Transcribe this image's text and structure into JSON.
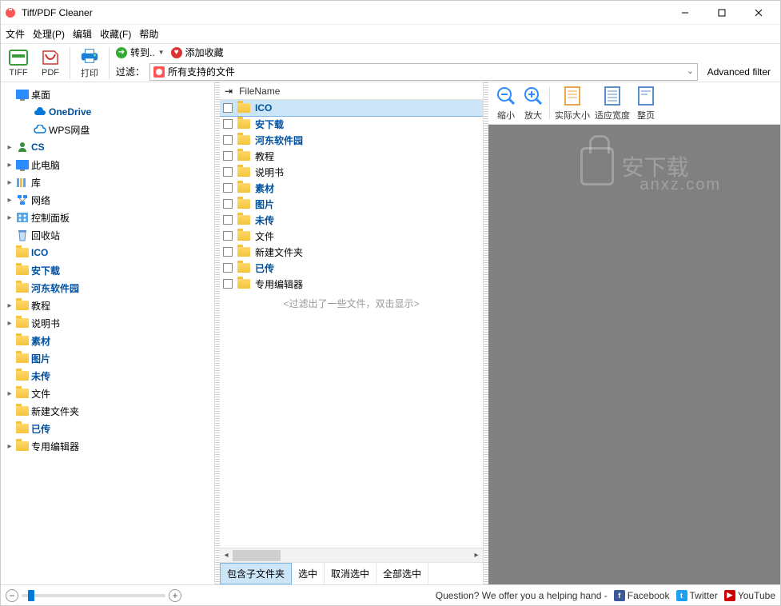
{
  "app": {
    "title": "Tiff/PDF Cleaner"
  },
  "menu": [
    "文件",
    "处理(P)",
    "编辑",
    "收藏(F)",
    "帮助"
  ],
  "toolbar": {
    "tiff": "TIFF",
    "pdf": "PDF",
    "print": "打印",
    "convert": "转到..",
    "favorite": "添加收藏",
    "filter_label": "过滤：",
    "filter_value": "所有支持的文件",
    "advanced": "Advanced filter"
  },
  "tree": [
    {
      "indent": 0,
      "exp": "",
      "icon": "monitor",
      "label": "桌面",
      "bold": false
    },
    {
      "indent": 1,
      "exp": "",
      "icon": "cloud-blue",
      "label": "OneDrive",
      "bold": true
    },
    {
      "indent": 1,
      "exp": "",
      "icon": "cloud-outline",
      "label": "WPS网盘",
      "bold": false
    },
    {
      "indent": 0,
      "exp": "▸",
      "icon": "user",
      "label": "CS",
      "bold": true
    },
    {
      "indent": 0,
      "exp": "▸",
      "icon": "monitor",
      "label": "此电脑",
      "bold": false
    },
    {
      "indent": 0,
      "exp": "▸",
      "icon": "library",
      "label": "库",
      "bold": false
    },
    {
      "indent": 0,
      "exp": "▸",
      "icon": "network",
      "label": "网络",
      "bold": false
    },
    {
      "indent": 0,
      "exp": "▸",
      "icon": "panel",
      "label": "控制面板",
      "bold": false
    },
    {
      "indent": 0,
      "exp": "",
      "icon": "recycle",
      "label": "回收站",
      "bold": false
    },
    {
      "indent": 0,
      "exp": "",
      "icon": "folder",
      "label": "ICO",
      "bold": true
    },
    {
      "indent": 0,
      "exp": "",
      "icon": "folder",
      "label": "安下载",
      "bold": true
    },
    {
      "indent": 0,
      "exp": "",
      "icon": "folder",
      "label": "河东软件园",
      "bold": true
    },
    {
      "indent": 0,
      "exp": "▸",
      "icon": "folder",
      "label": "教程",
      "bold": false
    },
    {
      "indent": 0,
      "exp": "▸",
      "icon": "folder",
      "label": "说明书",
      "bold": false
    },
    {
      "indent": 0,
      "exp": "",
      "icon": "folder",
      "label": "素材",
      "bold": true
    },
    {
      "indent": 0,
      "exp": "",
      "icon": "folder",
      "label": "图片",
      "bold": true
    },
    {
      "indent": 0,
      "exp": "",
      "icon": "folder",
      "label": "未传",
      "bold": true
    },
    {
      "indent": 0,
      "exp": "▸",
      "icon": "folder",
      "label": "文件",
      "bold": false
    },
    {
      "indent": 0,
      "exp": "",
      "icon": "folder",
      "label": "新建文件夹",
      "bold": false
    },
    {
      "indent": 0,
      "exp": "",
      "icon": "folder",
      "label": "已传",
      "bold": true
    },
    {
      "indent": 0,
      "exp": "▸",
      "icon": "folder",
      "label": "专用编辑器",
      "bold": false
    }
  ],
  "fileheader": {
    "pin": "📌",
    "col": "FileName"
  },
  "files": [
    {
      "name": "ICO",
      "bold": true,
      "selected": true
    },
    {
      "name": "安下载",
      "bold": true,
      "selected": false
    },
    {
      "name": "河东软件园",
      "bold": true,
      "selected": false
    },
    {
      "name": "教程",
      "bold": false,
      "selected": false
    },
    {
      "name": "说明书",
      "bold": false,
      "selected": false
    },
    {
      "name": "素材",
      "bold": true,
      "selected": false
    },
    {
      "name": "图片",
      "bold": true,
      "selected": false
    },
    {
      "name": "未传",
      "bold": true,
      "selected": false
    },
    {
      "name": "文件",
      "bold": false,
      "selected": false
    },
    {
      "name": "新建文件夹",
      "bold": false,
      "selected": false
    },
    {
      "name": "已传",
      "bold": true,
      "selected": false
    },
    {
      "name": "专用编辑器",
      "bold": false,
      "selected": false
    }
  ],
  "filter_msg": "<过滤出了一些文件，双击显示>",
  "bottom_buttons": {
    "include": "包含子文件夹",
    "check": "选中",
    "uncheck": "取消选中",
    "all": "全部选中"
  },
  "preview_tools": {
    "zoomout": "缩小",
    "zoomin": "放大",
    "actual": "实际大小",
    "fitwidth": "适应宽度",
    "fullpage": "整页"
  },
  "watermark": {
    "text": "安下载",
    "url": "anxz.com"
  },
  "status": {
    "question": "Question? We offer you a helping hand -",
    "fb": "Facebook",
    "tw": "Twitter",
    "yt": "YouTube"
  }
}
